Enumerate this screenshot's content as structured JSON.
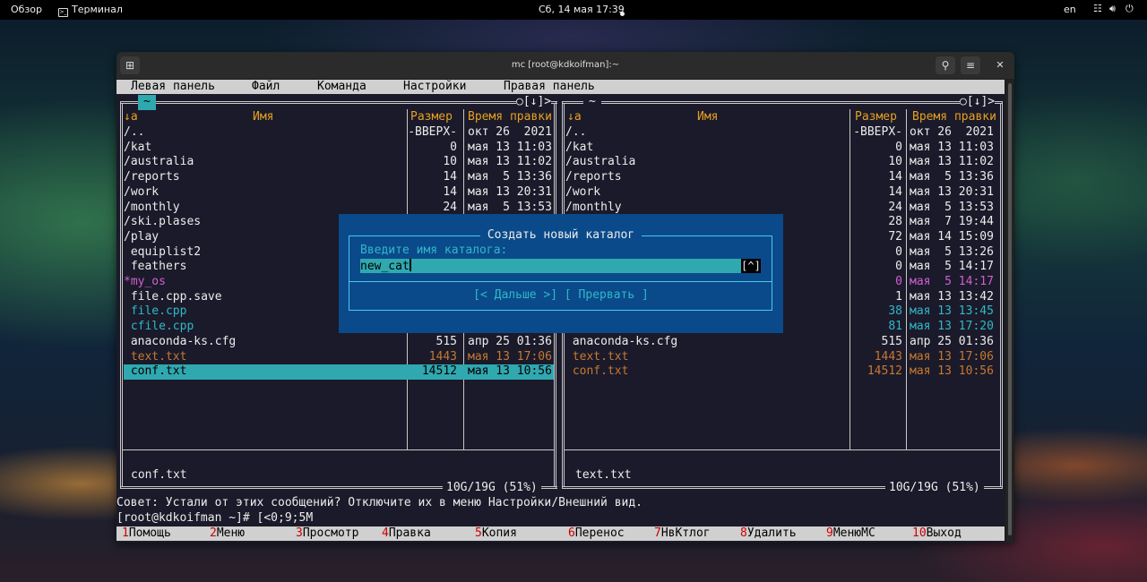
{
  "topbar": {
    "activities": "Обзор",
    "app": "Терминал",
    "clock": "Сб, 14 мая  17:39",
    "lang": "en"
  },
  "window": {
    "title": "mc [root@kdkoifman]:~"
  },
  "menu": [
    "Левая панель",
    "Файл",
    "Команда",
    "Настройки",
    "Правая панель"
  ],
  "left_panel": {
    "path": "~",
    "corner": "○[↓]>",
    "headers": {
      "name_sort": "↓a",
      "name": "Имя",
      "size": "Размер",
      "time": "Время правки"
    },
    "rows": [
      {
        "name": "/..",
        "size": "-ВВЕРХ-",
        "time": "окт 26  2021",
        "color": "w"
      },
      {
        "name": "/kat",
        "size": "0",
        "time": "мая 13 11:03",
        "color": "w"
      },
      {
        "name": "/australia",
        "size": "10",
        "time": "мая 13 11:02",
        "color": "w"
      },
      {
        "name": "/reports",
        "size": "14",
        "time": "мая  5 13:36",
        "color": "w"
      },
      {
        "name": "/work",
        "size": "14",
        "time": "мая 13 20:31",
        "color": "w"
      },
      {
        "name": "/monthly",
        "size": "24",
        "time": "мая  5 13:53",
        "color": "w"
      },
      {
        "name": "/ski.plases",
        "size": "",
        "time": "",
        "color": "w"
      },
      {
        "name": "/play",
        "size": "",
        "time": "",
        "color": "w"
      },
      {
        "name": " equiplist2",
        "size": "",
        "time": "",
        "color": "w"
      },
      {
        "name": " feathers",
        "size": "",
        "time": "",
        "color": "w"
      },
      {
        "name": "*my_os",
        "size": "",
        "time": "",
        "color": "m"
      },
      {
        "name": " file.cpp.save",
        "size": "",
        "time": "",
        "color": "w"
      },
      {
        "name": " file.cpp",
        "size": "",
        "time": "",
        "color": "c"
      },
      {
        "name": " cfile.cpp",
        "size": "",
        "time": "",
        "color": "c"
      },
      {
        "name": " anaconda-ks.cfg",
        "size": "515",
        "time": "апр 25 01:36",
        "color": "w"
      },
      {
        "name": " text.txt",
        "size": "1443",
        "time": "мая 13 17:06",
        "color": "o"
      },
      {
        "name": " conf.txt",
        "size": "14512",
        "time": "мая 13 10:56",
        "color": "sel"
      }
    ],
    "status": "conf.txt",
    "disk": "10G/19G (51%)"
  },
  "right_panel": {
    "path": "~",
    "corner": "○[↓]>",
    "headers": {
      "name_sort": "↓a",
      "name": "Имя",
      "size": "Размер",
      "time": "Время правки"
    },
    "rows": [
      {
        "name": "/..",
        "size": "-ВВЕРХ-",
        "time": "окт 26  2021",
        "color": "w"
      },
      {
        "name": "/kat",
        "size": "0",
        "time": "мая 13 11:03",
        "color": "w"
      },
      {
        "name": "/australia",
        "size": "10",
        "time": "мая 13 11:02",
        "color": "w"
      },
      {
        "name": "/reports",
        "size": "14",
        "time": "мая  5 13:36",
        "color": "w"
      },
      {
        "name": "/work",
        "size": "14",
        "time": "мая 13 20:31",
        "color": "w"
      },
      {
        "name": "/monthly",
        "size": "24",
        "time": "мая  5 13:53",
        "color": "w"
      },
      {
        "name": "",
        "size": "28",
        "time": "мая  7 19:44",
        "color": "w"
      },
      {
        "name": "",
        "size": "72",
        "time": "мая 14 15:09",
        "color": "w"
      },
      {
        "name": "",
        "size": "0",
        "time": "мая  5 13:26",
        "color": "w"
      },
      {
        "name": "",
        "size": "0",
        "time": "мая  5 14:17",
        "color": "w"
      },
      {
        "name": "",
        "size": "0",
        "time": "мая  5 14:17",
        "color": "m"
      },
      {
        "name": "",
        "size": "1",
        "time": "мая 13 13:42",
        "color": "w"
      },
      {
        "name": "",
        "size": "38",
        "time": "мая 13 13:45",
        "color": "c"
      },
      {
        "name": "",
        "size": "81",
        "time": "мая 13 17:20",
        "color": "c"
      },
      {
        "name": " anaconda-ks.cfg",
        "size": "515",
        "time": "апр 25 01:36",
        "color": "w"
      },
      {
        "name": " text.txt",
        "size": "1443",
        "time": "мая 13 17:06",
        "color": "o"
      },
      {
        "name": " conf.txt",
        "size": "14512",
        "time": "мая 13 10:56",
        "color": "o"
      }
    ],
    "status": "text.txt",
    "disk": "10G/19G (51%)"
  },
  "hint": "Совет: Устали от этих сообщений? Отключите их в меню Настройки/Внешний вид.",
  "prompt": "[root@kdkoifman ~]# [<0;9;5M",
  "fkeys": [
    {
      "n": "1",
      "label": "Помощь"
    },
    {
      "n": "2",
      "label": "Меню"
    },
    {
      "n": "3",
      "label": "Просмотр"
    },
    {
      "n": "4",
      "label": "Правка"
    },
    {
      "n": "5",
      "label": "Копия"
    },
    {
      "n": "6",
      "label": "Перенос"
    },
    {
      "n": "7",
      "label": "НвКтлог"
    },
    {
      "n": "8",
      "label": "Удалить"
    },
    {
      "n": "9",
      "label": "МенюMC"
    },
    {
      "n": "10",
      "label": "Выход"
    }
  ],
  "dialog": {
    "title": "Создать новый каталог",
    "label": "Введите имя каталога:",
    "value": "new_cat",
    "history": "[^]",
    "ok": "[< Дальше >]",
    "cancel": "[ Прервать ]"
  }
}
